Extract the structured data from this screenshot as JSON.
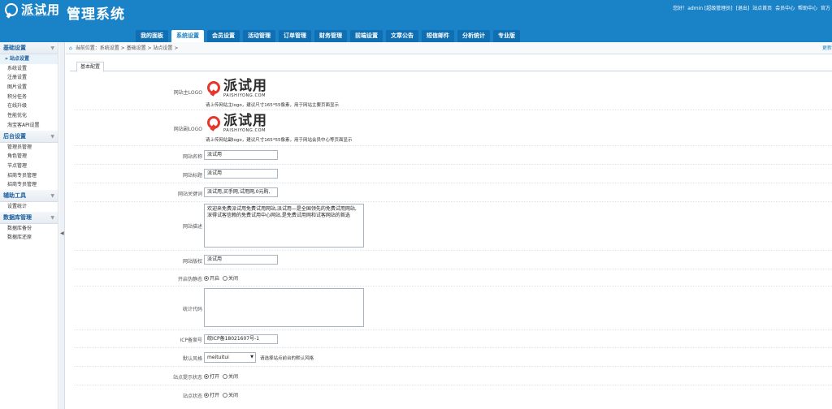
{
  "header": {
    "logo_text": "派试用",
    "logo_sub": "PAISHIYONG.COM",
    "system_title": "管理系统",
    "top_links": [
      "您好！admin [超级管理员]",
      "[退出]",
      "站点首页",
      "会员中心",
      "帮助中心",
      "官方"
    ],
    "nav_tabs": [
      "我的面板",
      "系统设置",
      "会员设置",
      "活动管理",
      "订单管理",
      "财务管理",
      "前端设置",
      "文章公告",
      "短信邮件",
      "分析统计",
      "专业版"
    ],
    "active_tab": "系统设置"
  },
  "sidebar": {
    "sections": [
      {
        "title": "基础设置",
        "items": [
          "站点设置",
          "系统设置",
          "注册设置",
          "图片设置",
          "积分任务",
          "在线升级",
          "性能优化",
          "淘宝客API设置"
        ]
      },
      {
        "title": "后台设置",
        "items": [
          "管理员管理",
          "角色管理",
          "节点管理",
          "招商专员管理",
          "招商专员管理"
        ]
      },
      {
        "title": "辅助工具",
        "items": [
          "设置统计"
        ]
      },
      {
        "title": "数据库管理",
        "items": [
          "数据库备份",
          "数据库还原"
        ]
      }
    ],
    "active_item": "站点设置",
    "collapse_arrow": "◀"
  },
  "breadcrumb": {
    "text": "当前位置：系统设置 > 基础设置 > 站点设置 >",
    "refresh": "更新"
  },
  "tab": "基本配置",
  "form": {
    "main_logo": {
      "label": "网站主LOGO",
      "brand_big": "派试用",
      "brand_small": "PAISHIYONG.COM",
      "hint": "请上传网站主logo，建议尺寸165*55像素，用于网站主要页面显示"
    },
    "sub_logo": {
      "label": "网站副LOGO",
      "brand_big": "派试用",
      "brand_small": "PAISHIYONG.COM",
      "hint": "请上传网站副logo，建议尺寸165*55像素，用于网站会员中心等页面显示"
    },
    "site_name": {
      "label": "网站名称",
      "value": "派试用"
    },
    "site_title": {
      "label": "网站标题",
      "value": "派试用"
    },
    "keywords": {
      "label": "网站关键词",
      "value": "派试用,买手网,试用网,0元购,"
    },
    "description": {
      "label": "网站描述",
      "value": "欢迎来免费派试用免费试用网站,派试用—是全国领先的免费试用网站,深得试客信赖的免费试用中心网站,是免费试用网和试客网站的首选"
    },
    "copyright": {
      "label": "网站版权",
      "value": "派试用"
    },
    "pseudo_static": {
      "label": "开启伪静态",
      "options": [
        "开启",
        "关闭"
      ],
      "selected": "开启"
    },
    "stats_code": {
      "label": "统计代码",
      "value": ""
    },
    "icp": {
      "label": "ICP备案号",
      "value": "皖ICP备18021607号-1"
    },
    "style": {
      "label": "默认风格",
      "value": "meituitui",
      "hint": "请选择站点前台的默认风格"
    },
    "site_hint": {
      "label": "站点提示状态",
      "options": [
        "打开",
        "关闭"
      ],
      "selected": "打开"
    },
    "site_status": {
      "label": "站点状态",
      "options": [
        "打开",
        "关闭"
      ],
      "selected": "打开"
    }
  },
  "colors": {
    "header": "#1a82c6",
    "accent": "#1a5fa0",
    "logo_red": "#e5372b"
  }
}
